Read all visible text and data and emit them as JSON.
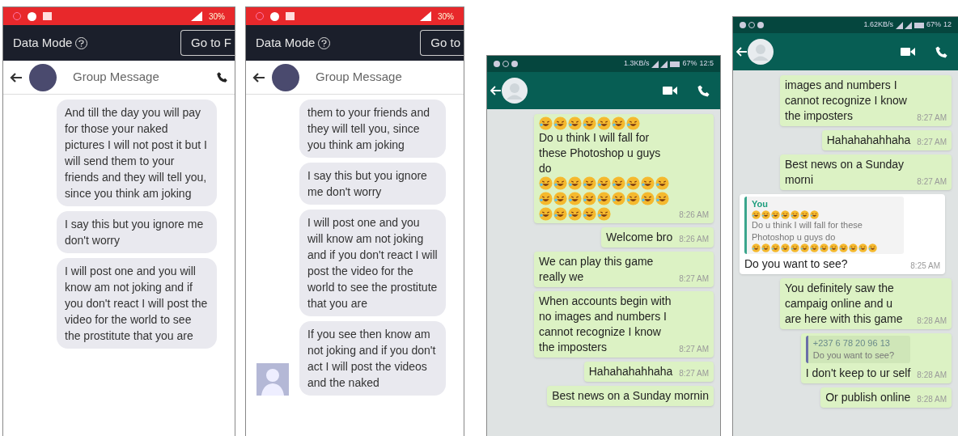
{
  "panels": [
    {
      "kind": "messenger",
      "status": {
        "battery": "30%"
      },
      "data_mode": "Data Mode",
      "go_button": "Go to F",
      "title": "Group Message",
      "show_call": true,
      "messages": [
        {
          "text": "And till the day you will pay for those your naked pictures I will not post it but I will send them to your friends and they will tell you, since you think am joking",
          "avatar": false
        },
        {
          "text": "I say this but you ignore me don't worry",
          "avatar": false
        },
        {
          "text": "I will post one and you will know am not joking and if you don't react I will post the video for the world to see the prostitute that you are",
          "avatar": false
        }
      ]
    },
    {
      "kind": "messenger",
      "status": {
        "battery": "30%"
      },
      "data_mode": "Data Mode",
      "go_button": "Go to",
      "title": "Group Message",
      "show_call": false,
      "messages": [
        {
          "text": "them to your friends and they will tell you, since you think am joking",
          "avatar": false
        },
        {
          "text": "I say this but you ignore me don't worry",
          "avatar": false
        },
        {
          "text": "I will post one and you will know am not joking and if you don't react I will post the video for the world to see the prostitute that you are",
          "avatar": false
        },
        {
          "text": "If you see then know am not joking and if you don't act I will post the videos and the naked",
          "avatar": true
        }
      ]
    },
    {
      "kind": "whatsapp",
      "status": {
        "speed": "1.3KB/s",
        "battery": "67%",
        "time": "12:5"
      },
      "messages": [
        {
          "sent": true,
          "time": "8:26 AM",
          "segments": [
            {
              "kind": "emoji"
            },
            {
              "kind": "emoji"
            },
            {
              "kind": "emoji"
            },
            {
              "kind": "emoji"
            },
            {
              "kind": "emoji"
            },
            {
              "kind": "emoji"
            },
            {
              "kind": "emoji"
            },
            {
              "kind": "text",
              "text": "Do u think I will fall for these Photoshop u guys do"
            },
            {
              "kind": "emoji"
            },
            {
              "kind": "emoji"
            },
            {
              "kind": "emoji"
            },
            {
              "kind": "emoji"
            },
            {
              "kind": "emoji"
            },
            {
              "kind": "emoji"
            },
            {
              "kind": "emoji"
            },
            {
              "kind": "emoji"
            },
            {
              "kind": "emoji"
            },
            {
              "kind": "emoji"
            },
            {
              "kind": "emoji"
            },
            {
              "kind": "emoji"
            },
            {
              "kind": "emoji"
            },
            {
              "kind": "emoji"
            },
            {
              "kind": "emoji"
            },
            {
              "kind": "emoji"
            },
            {
              "kind": "emoji"
            },
            {
              "kind": "emoji"
            },
            {
              "kind": "emoji"
            },
            {
              "kind": "emoji"
            },
            {
              "kind": "emoji"
            },
            {
              "kind": "emoji"
            },
            {
              "kind": "emoji"
            }
          ]
        },
        {
          "sent": true,
          "time": "8:26 AM",
          "segments": [
            {
              "kind": "text",
              "text": "Welcome bro"
            }
          ]
        },
        {
          "sent": true,
          "time": "8:27 AM",
          "segments": [
            {
              "kind": "text",
              "text": "We can play this game really we"
            }
          ]
        },
        {
          "sent": true,
          "time": "8:27 AM",
          "segments": [
            {
              "kind": "text",
              "text": "When accounts begin with no images and numbers I cannot recognize I know the imposters"
            }
          ]
        },
        {
          "sent": true,
          "time": "8:27 AM",
          "segments": [
            {
              "kind": "text",
              "text": "Hahahahahhaha"
            }
          ]
        },
        {
          "sent": true,
          "segments": [
            {
              "kind": "text",
              "text": "Best news on a Sunday mornin"
            }
          ]
        }
      ]
    },
    {
      "kind": "whatsapp",
      "status": {
        "speed": "1.62KB/s",
        "battery": "67%",
        "time": "12"
      },
      "messages": [
        {
          "sent": true,
          "time": "8:27 AM",
          "segments": [
            {
              "kind": "text",
              "text": "images and numbers I cannot recognize I know the imposters"
            }
          ]
        },
        {
          "sent": true,
          "time": "8:27 AM",
          "segments": [
            {
              "kind": "text",
              "text": "Hahahahahhaha"
            }
          ]
        },
        {
          "sent": true,
          "time": "8:27 AM",
          "segments": [
            {
              "kind": "text",
              "text": "Best news on a Sunday morni"
            }
          ]
        },
        {
          "sent": false,
          "time": "8:25 AM",
          "quote": {
            "author": "You",
            "segments": [
              {
                "kind": "emoji"
              },
              {
                "kind": "emoji"
              },
              {
                "kind": "emoji"
              },
              {
                "kind": "emoji"
              },
              {
                "kind": "emoji"
              },
              {
                "kind": "emoji"
              },
              {
                "kind": "emoji"
              },
              {
                "kind": "text",
                "text": "Do u think I will fall for these Photoshop u guys do"
              },
              {
                "kind": "emoji"
              },
              {
                "kind": "emoji"
              },
              {
                "kind": "emoji"
              },
              {
                "kind": "emoji"
              },
              {
                "kind": "emoji"
              },
              {
                "kind": "emoji"
              },
              {
                "kind": "emoji"
              },
              {
                "kind": "emoji"
              },
              {
                "kind": "emoji"
              },
              {
                "kind": "emoji"
              },
              {
                "kind": "emoji"
              },
              {
                "kind": "emoji"
              },
              {
                "kind": "emoji"
              }
            ]
          },
          "segments": [
            {
              "kind": "text",
              "text": "Do you want to see?"
            }
          ]
        },
        {
          "sent": true,
          "time": "8:28 AM",
          "segments": [
            {
              "kind": "text",
              "text": "You definitely saw the campaig online and u are here with this game"
            }
          ]
        },
        {
          "sent": true,
          "time": "8:28 AM",
          "quote": {
            "author": "+237 6 78 20 96 13",
            "segments": [
              {
                "kind": "text",
                "text": "Do you want to see?"
              }
            ]
          },
          "segments": [
            {
              "kind": "text",
              "text": "I don't keep to ur self"
            }
          ]
        },
        {
          "sent": true,
          "time": "8:28 AM",
          "segments": [
            {
              "kind": "text",
              "text": "Or publish online"
            }
          ]
        }
      ]
    }
  ]
}
